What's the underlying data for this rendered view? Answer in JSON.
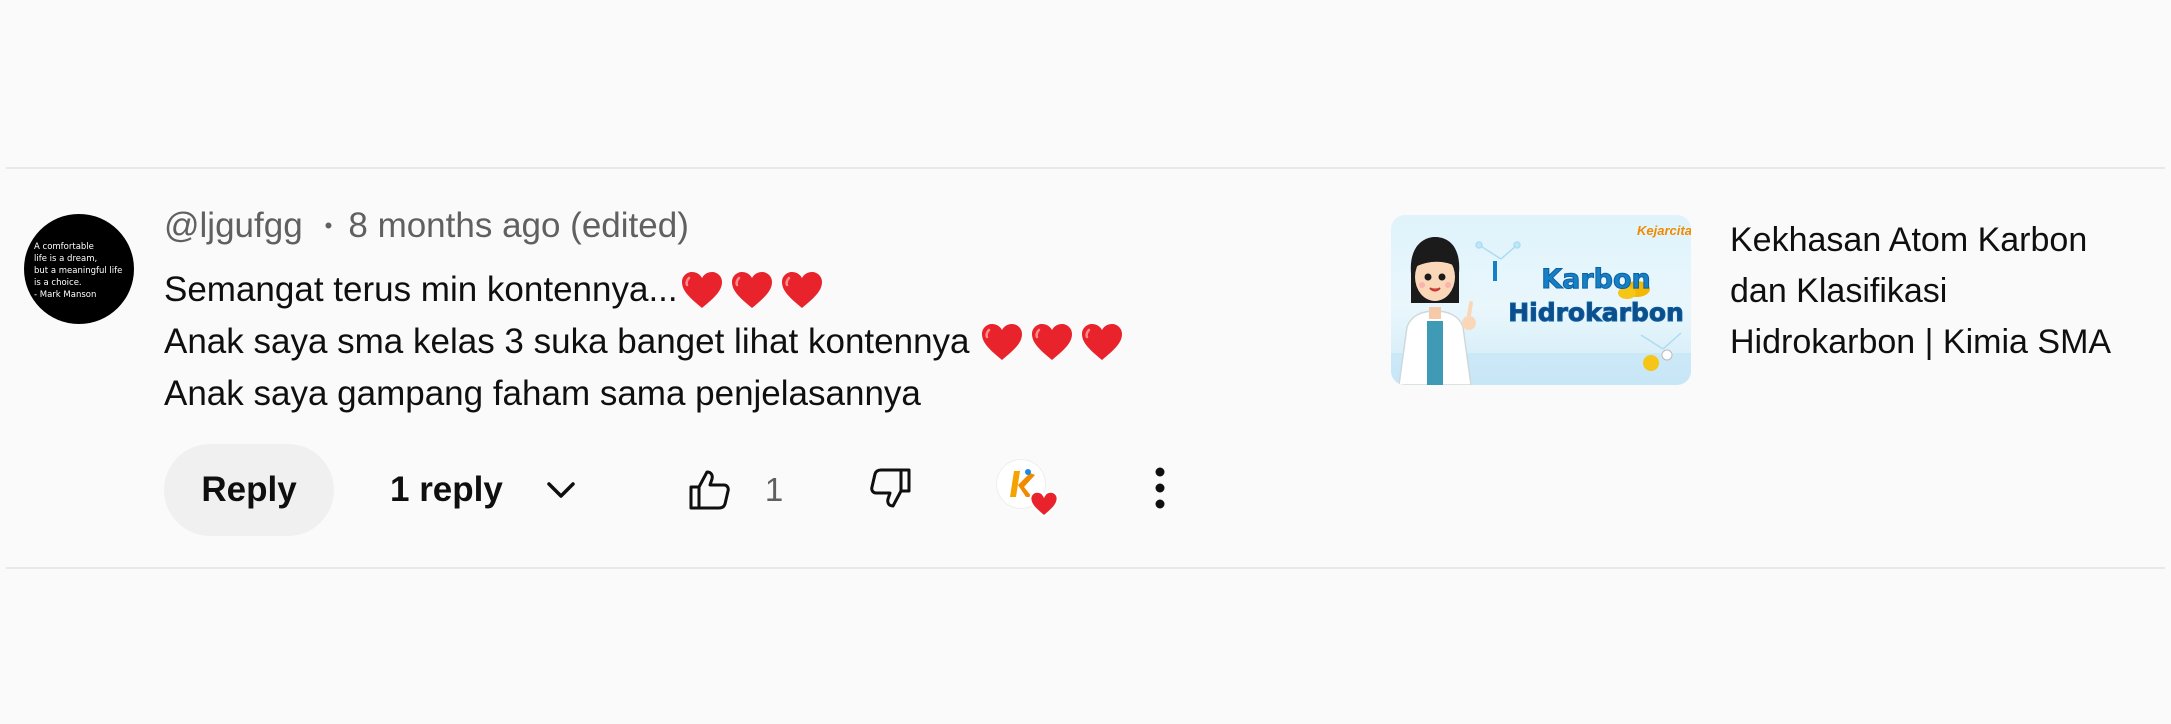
{
  "comment": {
    "avatar_quote": "A comfortable\nlife is a dream,\nbut a meaningful life\nis a choice.\n- Mark Manson",
    "author": "@ljgufgg",
    "separator": "•",
    "timestamp": "8 months ago (edited)",
    "lines": [
      {
        "text": "Semangat terus min kontennya...",
        "hearts": 3
      },
      {
        "text": "Anak saya sma kelas 3 suka banget lihat kontennya",
        "hearts": 3
      },
      {
        "text": "Anak saya gampang faham sama penjelasannya",
        "hearts": 0
      }
    ],
    "actions": {
      "reply_label": "Reply",
      "replies_label": "1 reply",
      "like_count": "1"
    },
    "icons": {
      "heart": "heart-icon",
      "expand": "chevron-down-icon",
      "like": "thumbs-up-icon",
      "dislike": "thumbs-down-icon",
      "creator": "creator-heart-icon",
      "more": "more-vertical-icon"
    }
  },
  "video": {
    "thumbnail": {
      "brand": "Kejarcita",
      "title_line1": "Karbon",
      "title_line2": "Hidrokarbon"
    },
    "title_lines": [
      "Kekhasan Atom Karbon",
      "dan Klasifikasi",
      "Hidrokarbon | Kimia SMA"
    ]
  },
  "colors": {
    "background": "#fafafa",
    "text_primary": "#0f0f0f",
    "text_secondary": "#606060",
    "heart_red": "#e8232b",
    "reply_button_bg": "#f0f0f0",
    "brand_orange": "#f28a00",
    "thumb_blue": "#1580c6"
  }
}
